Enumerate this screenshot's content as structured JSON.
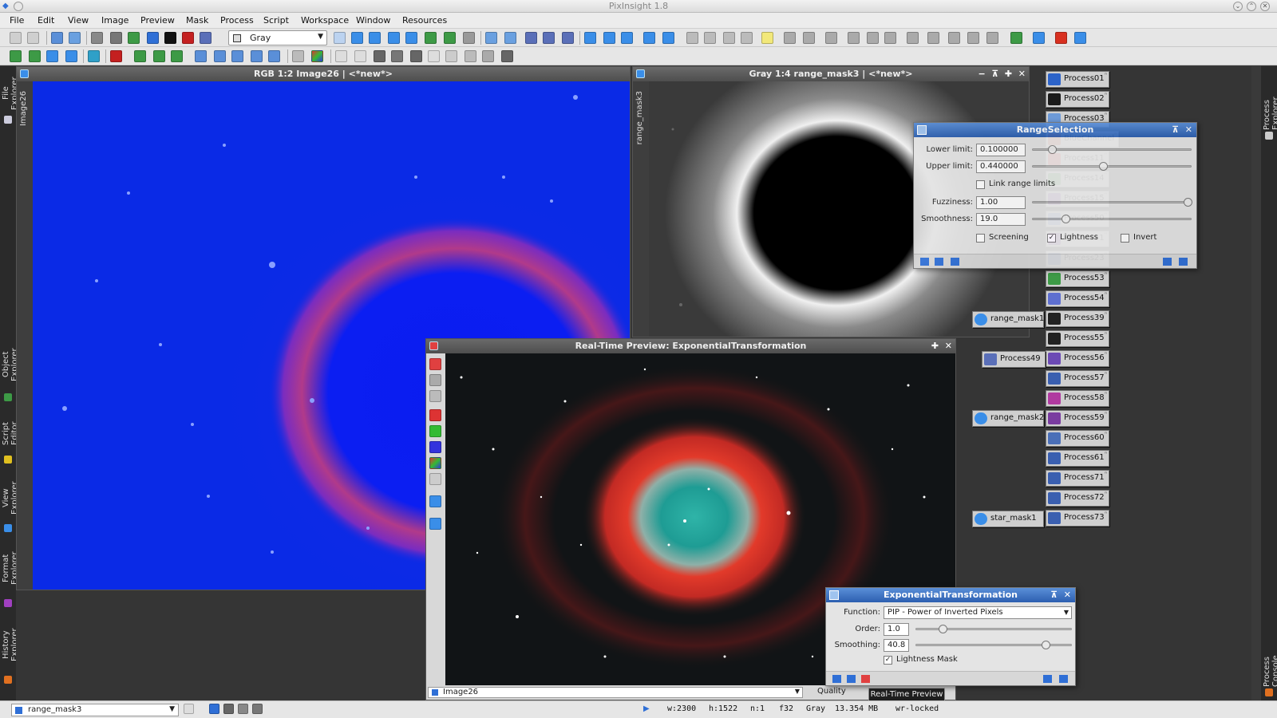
{
  "app": {
    "title": "PixInsight 1.8"
  },
  "menu": [
    "File",
    "Edit",
    "View",
    "Image",
    "Preview",
    "Mask",
    "Process",
    "Script",
    "Workspace",
    "Window",
    "Resources"
  ],
  "toolbar": {
    "mask_mode": "Gray"
  },
  "left_tabs": [
    "File Explorer",
    "Object Explorer",
    "Script Editor",
    "View Explorer",
    "Format Explorer",
    "History Explorer"
  ],
  "right_tabs": [
    "Process Explorer",
    "Process Console"
  ],
  "windows": {
    "rgb": {
      "title": "RGB 1:2 Image26 | <*new*>",
      "tab": "Image26"
    },
    "gray": {
      "title": "Gray 1:4 range_mask3 | <*new*>",
      "tab": "range_mask3"
    },
    "preview": {
      "title": "Real-Time Preview: ExponentialTransformation",
      "view_select": "Image26",
      "quality_label": "Quality"
    }
  },
  "range_selection": {
    "title": "RangeSelection",
    "lower_label": "Lower limit:",
    "lower_value": "0.100000",
    "upper_label": "Upper limit:",
    "upper_value": "0.440000",
    "link_label": "Link range limits",
    "fuzz_label": "Fuzziness:",
    "fuzz_value": "1.00",
    "smooth_label": "Smoothness:",
    "smooth_value": "19.0",
    "screening_label": "Screening",
    "lightness_label": "Lightness",
    "invert_label": "Invert",
    "lower_level": 0.1,
    "upper_level": 0.44,
    "fuzz_level": 1.0,
    "smooth_level": 0.19,
    "link_checked": false,
    "screening_checked": false,
    "lightness_checked": true,
    "invert_checked": false
  },
  "exp_transform": {
    "title": "ExponentialTransformation",
    "function_label": "Function:",
    "function_value": "PIP - Power of Inverted Pixels",
    "order_label": "Order:",
    "order_value": "1.0",
    "smoothing_label": "Smoothing:",
    "smoothing_value": "40.8",
    "lightness_mask_label": "Lightness Mask",
    "lightness_mask_checked": true
  },
  "tooltip": "Real-Time Preview",
  "process_icons": [
    {
      "label": "Process01",
      "color": "#2c63c9"
    },
    {
      "label": "Process02",
      "color": "#1b1b1b"
    },
    {
      "label": "Process03",
      "color": "#6d9ad8"
    },
    {
      "label": "BlueChannel",
      "color": "#c23a2a"
    },
    {
      "label": "Process11",
      "color": "#d8372d"
    },
    {
      "label": "Process14",
      "color": "#3d9a46"
    },
    {
      "label": "Process15",
      "color": "#7b3aa6"
    },
    {
      "label": "Process50",
      "color": "#5a7bc4"
    },
    {
      "label": "Process51",
      "color": "#7a3ca0"
    },
    {
      "label": "Process23",
      "color": "#4a6fb8"
    },
    {
      "label": "Process53",
      "color": "#3d9a46"
    },
    {
      "label": "Process54",
      "color": "#5e6fd0"
    },
    {
      "label": "Process39",
      "color": "#222222"
    },
    {
      "label": "Process55",
      "color": "#222222"
    },
    {
      "label": "Process56",
      "color": "#6c4ab5"
    },
    {
      "label": "Process57",
      "color": "#3a5fb0"
    },
    {
      "label": "Process58",
      "color": "#b03aa0"
    },
    {
      "label": "Process59",
      "color": "#7a3ca0"
    },
    {
      "label": "Process60",
      "color": "#4a6fb8"
    },
    {
      "label": "Process61",
      "color": "#3a5fb0"
    },
    {
      "label": "Process71",
      "color": "#3a5fb0"
    },
    {
      "label": "Process72",
      "color": "#3a5fb0"
    },
    {
      "label": "Process73",
      "color": "#3a5fb0"
    }
  ],
  "mask_icons": [
    {
      "label": "range_mask1"
    },
    {
      "label": "Process49"
    },
    {
      "label": "range_mask2"
    },
    {
      "label": "star_mask1"
    }
  ],
  "status": {
    "view": "range_mask3",
    "width": "w:2300",
    "height": "h:1522",
    "channels": "n:1",
    "format": "f32",
    "color_space": "Gray",
    "size": "13.354 MB",
    "lock": "wr-locked"
  }
}
